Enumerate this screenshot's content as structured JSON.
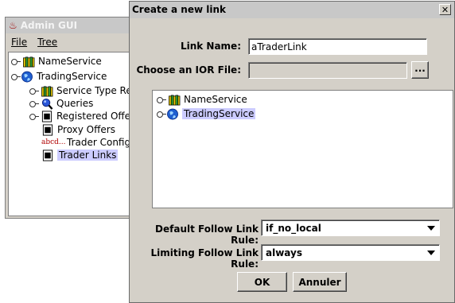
{
  "admin": {
    "title": "Admin GUI",
    "menu": [
      "File",
      "Tree"
    ],
    "tree": [
      {
        "label": "NameService",
        "icon": "books-icon"
      },
      {
        "label": "TradingService",
        "icon": "globe-icon"
      },
      {
        "label": "Service Type Rep",
        "icon": "books-icon"
      },
      {
        "label": "Queries",
        "icon": "magnifier-icon"
      },
      {
        "label": "Registered Offers",
        "icon": "document-icon"
      },
      {
        "label": "Proxy Offers",
        "icon": "document-icon"
      },
      {
        "label": "Trader Config",
        "icon": "abcd-icon",
        "icon_text": "abcd..."
      },
      {
        "label": "Trader Links",
        "icon": "document-icon",
        "selected": true
      }
    ]
  },
  "dialog": {
    "title": "Create a new link",
    "close_symbol": "✕",
    "link_name_label": "Link Name:",
    "link_name_value": "aTraderLink",
    "ior_label": "Choose an IOR File:",
    "ior_value": "",
    "browse_label": "...",
    "tree": [
      {
        "label": "NameService",
        "icon": "books-icon"
      },
      {
        "label": "TradingService",
        "icon": "globe-icon",
        "selected": true
      }
    ],
    "default_rule_label": "Default Follow Link Rule:",
    "default_rule_value": "if_no_local",
    "limiting_rule_label": "Limiting Follow Link Rule:",
    "limiting_rule_value": "always",
    "ok_label": "OK",
    "cancel_label": "Annuler"
  },
  "colors": {
    "selection": "#ccccff",
    "panel": "#d4d0c8",
    "titlebar": "#c8c8c8"
  }
}
